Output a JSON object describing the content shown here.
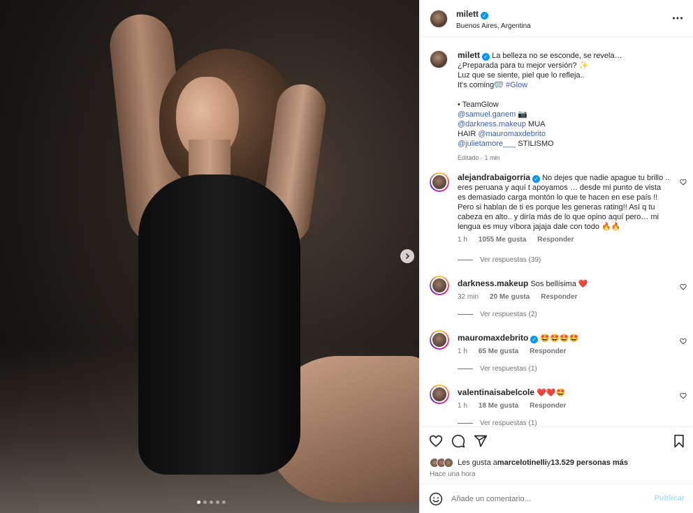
{
  "post": {
    "username": "milett",
    "location": "Buenos Aires, Argentina",
    "more_icon": "more-horizontal-icon"
  },
  "media": {
    "carousel_count": 5,
    "carousel_active": 1
  },
  "caption": {
    "username": "milett",
    "line1": "La belleza no se esconde, se revela…",
    "line2": "¿Preparada para tu mejor versión? ✨",
    "line3": "Luz que se siente, piel que lo refleja..",
    "line4_text": "It's coming🥽 ",
    "line4_hashtag": "#Glow",
    "team_label": "• TeamGlow",
    "credit1_handle": "@samuel.ganem",
    "credit1_suffix": " 📷",
    "credit2_handle": "@darkness.makeup",
    "credit2_suffix": " MUA",
    "credit3_prefix": "HAIR ",
    "credit3_handle": "@mauromaxdebrito",
    "credit4_handle": "@julietamore___",
    "credit4_suffix": " STILISMO",
    "edited": "Editado · 1 min"
  },
  "comments": [
    {
      "username": "alejandrabaigorria",
      "verified": true,
      "text": "No dejes que nadie apague tu brillo .. eres peruana y aquí t apoyamos … desde mi punto de vista es demasiado carga montón lo que te hacen en ese país !! Pero si hablan de ti es porque les generas rating!! Así q tu cabeza en alto.. y diría más de lo que opino aquí pero… mi lengua es muy víbora jajaja dale con todo 🔥🔥",
      "time": "1 h",
      "likes": "1055 Me gusta",
      "reply": "Responder",
      "replies": "Ver respuestas (39)"
    },
    {
      "username": "darkness.makeup",
      "verified": false,
      "text": "Sos bellísima ❤️",
      "time": "32 min",
      "likes": "20 Me gusta",
      "reply": "Responder",
      "replies": "Ver respuestas (2)"
    },
    {
      "username": "mauromaxdebrito",
      "verified": true,
      "text": "🤩🤩🤩🤩",
      "time": "1 h",
      "likes": "65 Me gusta",
      "reply": "Responder",
      "replies": "Ver respuestas (1)"
    },
    {
      "username": "valentinaisabelcole",
      "verified": false,
      "text": "❤️❤️🤩",
      "time": "1 h",
      "likes": "18 Me gusta",
      "reply": "Responder",
      "replies": "Ver respuestas (1)"
    }
  ],
  "actions": {
    "likes_prefix": "Les gusta a ",
    "likes_user": "marcelotinelli",
    "likes_middle": " y ",
    "likes_count": "13.529 personas más",
    "time_ago": "Hace una hora"
  },
  "add_comment": {
    "placeholder": "Añade un comentario...",
    "publish": "Publicar"
  },
  "colors": {
    "verified": "#0095f6",
    "link": "#00376b",
    "publish_disabled": "#b2dffc"
  }
}
